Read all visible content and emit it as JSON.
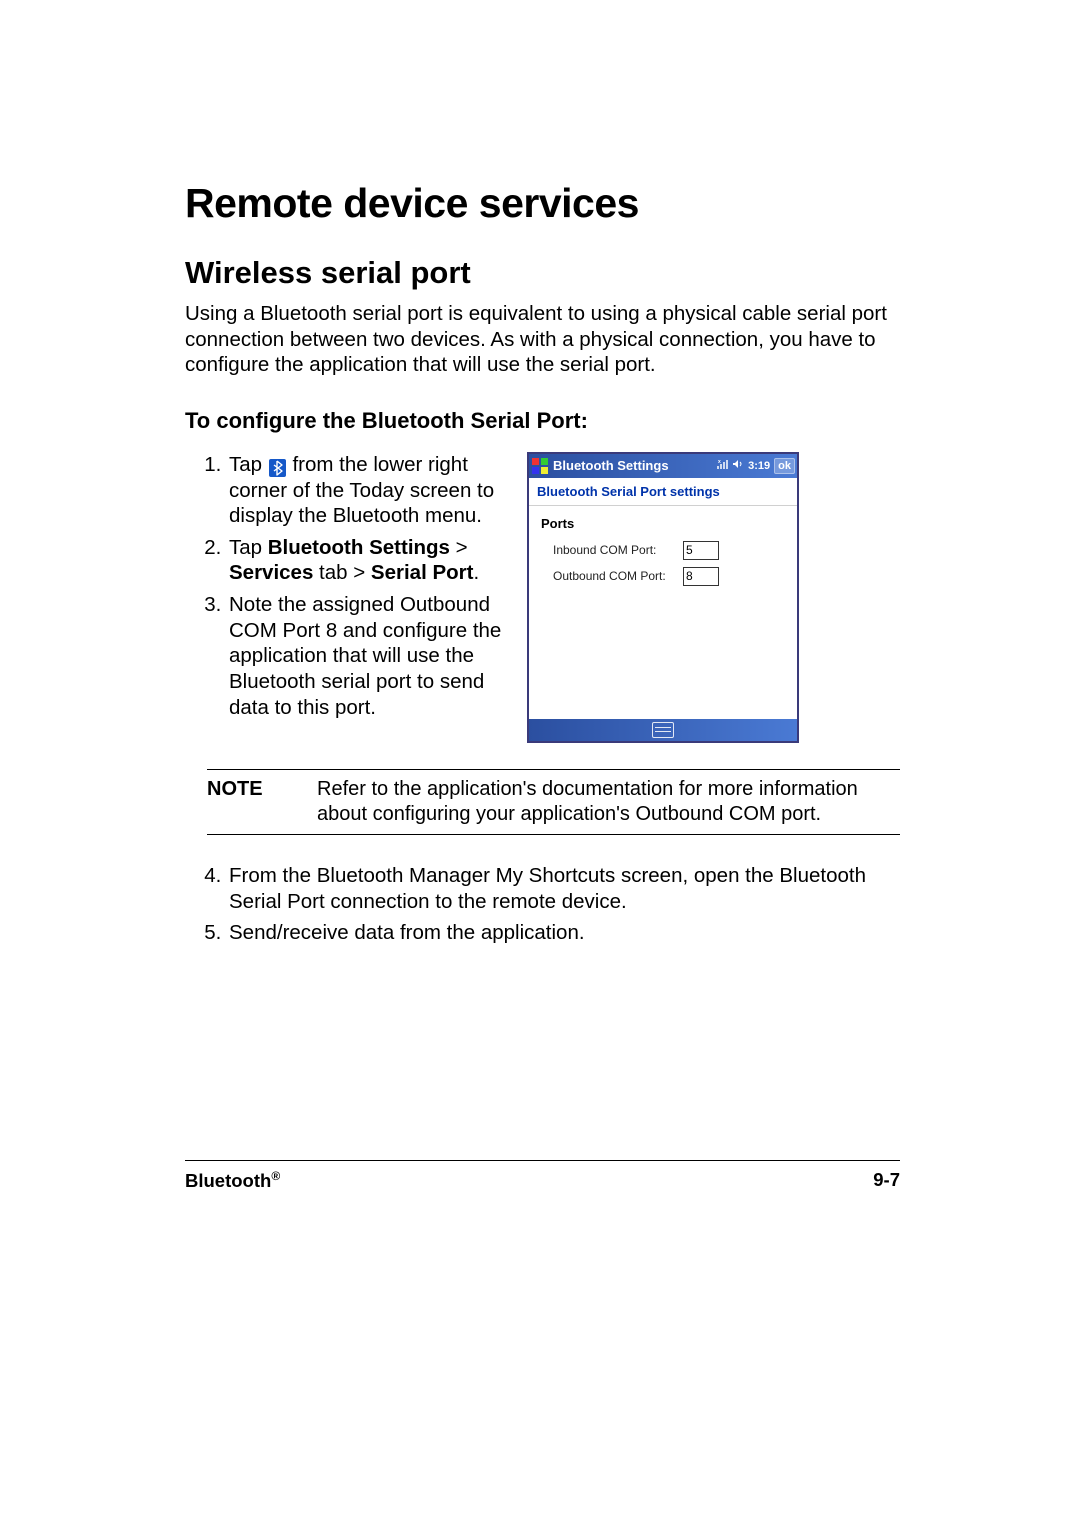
{
  "header": {
    "title": "Remote device services",
    "subtitle": "Wireless serial port"
  },
  "intro": "Using a Bluetooth serial port is equivalent to using a physical cable serial port connection between two devices. As with a physical connection, you have to configure the application that will use the serial port.",
  "procedure_title": "To configure the Bluetooth Serial Port:",
  "steps": {
    "s1a": "Tap ",
    "s1b": " from the lower right corner of the Today screen to display the Bluetooth menu.",
    "s2a": "Tap ",
    "s2_bt_settings": "Bluetooth Settings",
    "s2b": " > ",
    "s2_services": "Services",
    "s2c": " tab > ",
    "s2_serial_port": "Serial Port",
    "s2d": ".",
    "s3": "Note the assigned Outbound COM Port 8 and configure the application that will use the Bluetooth serial port to send data to this port.",
    "s4": "From the Bluetooth Manager My Shortcuts screen, open the Bluetooth Serial Port connection to the remote device.",
    "s5": "Send/receive data from the application."
  },
  "note": {
    "label": "NOTE",
    "text": "Refer to the application's documentation for more information about configuring your application's Outbound COM port."
  },
  "pda": {
    "window_title": "Bluetooth Settings",
    "time": "3:19",
    "ok": "ok",
    "subtitle": "Bluetooth Serial Port settings",
    "group": "Ports",
    "inbound_label": "Inbound COM Port:",
    "inbound_value": "5",
    "outbound_label": "Outbound COM Port:",
    "outbound_value": "8"
  },
  "footer": {
    "left": "Bluetooth",
    "reg": "®",
    "right": "9-7"
  }
}
